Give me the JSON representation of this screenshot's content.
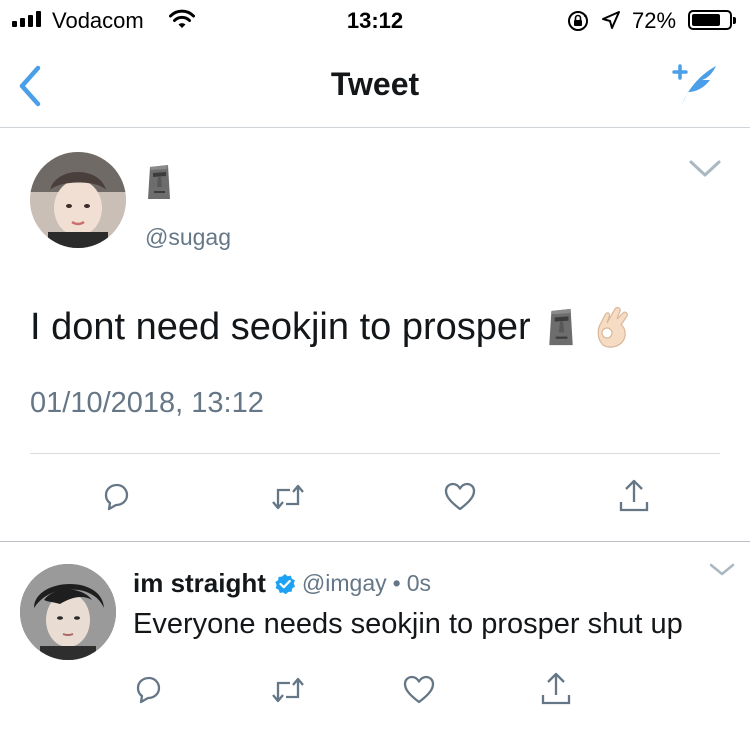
{
  "status_bar": {
    "carrier": "Vodacom",
    "time": "13:12",
    "battery_percent": "72%",
    "battery_level": 0.72
  },
  "nav": {
    "title": "Tweet",
    "back_icon": "chevron-left-icon",
    "compose_icon": "compose-tweet-icon"
  },
  "tweet": {
    "display_name_emoji": "moai-emoji",
    "handle": "@sugag",
    "text": "I dont need seokjin to prosper",
    "text_emojis": [
      "moai-emoji",
      "ok-hand-emoji"
    ],
    "timestamp": "01/10/2018, 13:12",
    "actions": [
      "reply-icon",
      "retweet-icon",
      "like-icon",
      "share-icon"
    ]
  },
  "reply": {
    "name": "im straight",
    "verified": true,
    "handle": "@imgay",
    "separator": "•",
    "time": "0s",
    "text": "Everyone needs seokjin to prosper shut up",
    "actions": [
      "reply-icon",
      "retweet-icon",
      "like-icon",
      "share-icon"
    ]
  },
  "colors": {
    "accent": "#4a9fe8",
    "secondary_text": "#657786",
    "icon_gray": "#657786",
    "verified_blue": "#1da1f2"
  }
}
